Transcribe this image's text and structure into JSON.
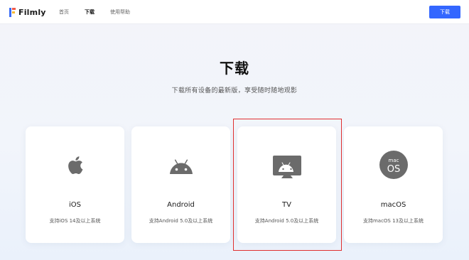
{
  "header": {
    "logo_text": "Filmly",
    "nav": [
      "首页",
      "下载",
      "使用帮助"
    ],
    "active_nav": "下载",
    "download_button": "下载"
  },
  "hero": {
    "title": "下载",
    "subtitle": "下载所有设备的最新版，享受随时随地观影"
  },
  "platforms": [
    {
      "name": "iOS",
      "desc": "支持iOS 14及以上系统",
      "icon": "apple-icon"
    },
    {
      "name": "Android",
      "desc": "支持Android 5.0及以上系统",
      "icon": "android-icon"
    },
    {
      "name": "TV",
      "desc": "支持Android 5.0及以上系统",
      "icon": "android-tv-icon",
      "highlighted": true
    },
    {
      "name": "macOS",
      "desc": "支持macOS 13及以上系统",
      "icon": "macos-icon",
      "icon_text": [
        "mac",
        "OS"
      ]
    }
  ],
  "colors": {
    "accent": "#3366ff",
    "icon_gray": "#6b6b6b",
    "highlight_border": "#e03030"
  }
}
